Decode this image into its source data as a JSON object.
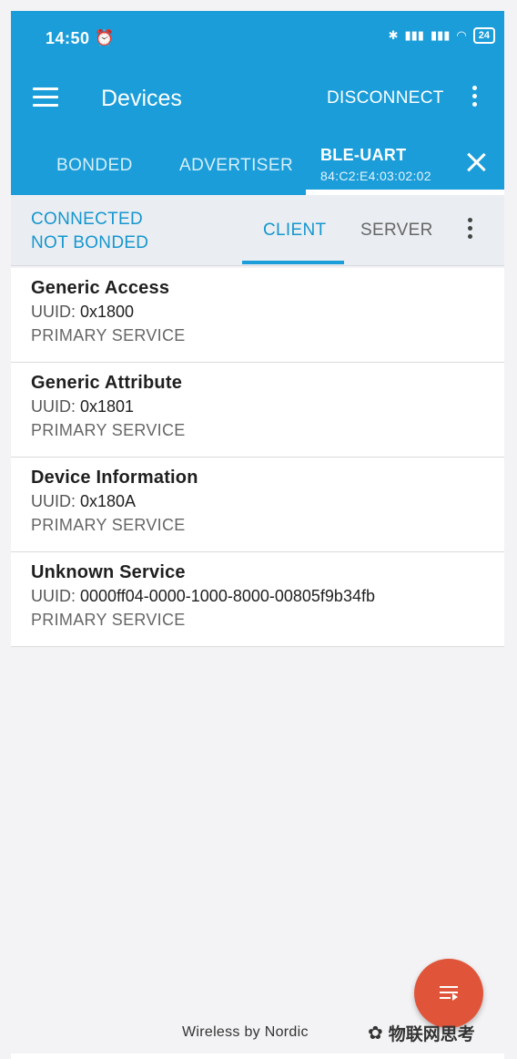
{
  "status_bar": {
    "time": "14:50",
    "alarm_icon": "alarm-clock-icon",
    "signal_1": "὏6",
    "battery": "24"
  },
  "app_bar": {
    "title": "Devices",
    "disconnect_label": "DISCONNECT"
  },
  "device_tabs": {
    "bonded": "BONDED",
    "advertiser": "ADVERTISER",
    "active_name": "BLE-UART",
    "active_address": "84:C2:E4:03:02:02"
  },
  "connection": {
    "state": "CONNECTED",
    "bond_state": "NOT BONDED",
    "client_tab": "CLIENT",
    "server_tab": "SERVER"
  },
  "uuid_label": "UUID:",
  "services": [
    {
      "name": "Generic Access",
      "uuid": "0x1800",
      "type": "PRIMARY SERVICE"
    },
    {
      "name": "Generic Attribute",
      "uuid": "0x1801",
      "type": "PRIMARY SERVICE"
    },
    {
      "name": "Device Information",
      "uuid": "0x180A",
      "type": "PRIMARY SERVICE"
    },
    {
      "name": "Unknown Service",
      "uuid": "0000ff04-0000-1000-8000-00805f9b34fb",
      "type": "PRIMARY SERVICE"
    }
  ],
  "footer": "Wireless by Nordic",
  "watermark": "物联网思考",
  "colors": {
    "primary": "#1b9dd9",
    "accent_text": "#1596cf",
    "fab": "#e0553a"
  }
}
